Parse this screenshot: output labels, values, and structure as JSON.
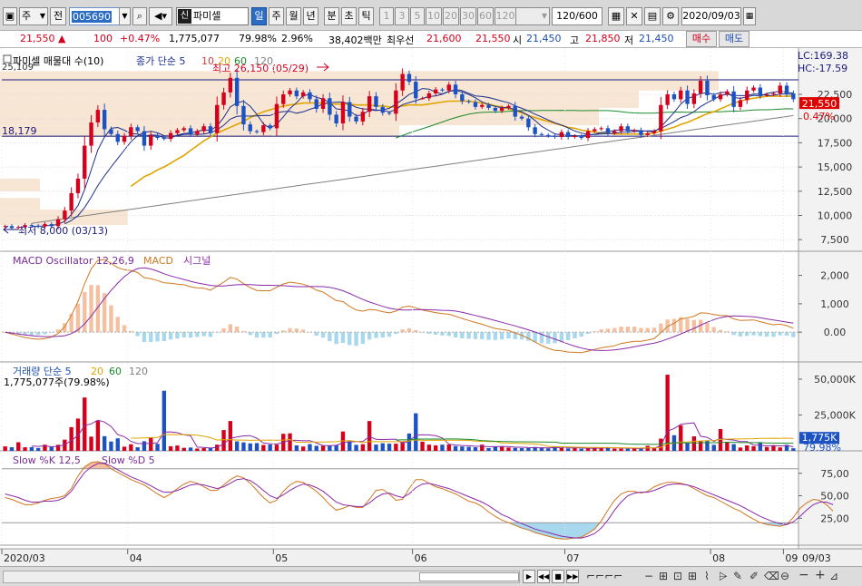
{
  "toolbar": {
    "type_label": "주",
    "prev_label": "전",
    "code": "005690",
    "name_prefix": "신",
    "name": "파미셀",
    "periods": [
      "일",
      "주",
      "월",
      "년",
      "분",
      "초",
      "틱"
    ],
    "selected_period": "일",
    "intervals": [
      "1",
      "3",
      "5",
      "10",
      "20",
      "30",
      "60",
      "120"
    ],
    "count": "120/600",
    "date": "2020/09/03"
  },
  "quote": {
    "price": "21,550",
    "change": "100",
    "change_pct": "+0.47%",
    "volume": "1,775,077",
    "volume_ratio": "79.98%",
    "turnover_ratio": "2.96%",
    "amount": "38,402백만",
    "best_label": "최우선",
    "best_ask": "21,600",
    "best_bid": "21,550",
    "open_label": "시",
    "open": "21,450",
    "high_label": "고",
    "high": "21,850",
    "low_label": "저",
    "low": "21,450",
    "buy_label": "매수",
    "sell_label": "매도"
  },
  "colors": {
    "up": "#d4001c",
    "down": "#1c52c4",
    "ma5": "#1a2f8f",
    "ma20": "#e0a400",
    "ma60": "#1a8a2a",
    "ma120": "#808080",
    "macd": "#d07820",
    "signal": "#8a2aa8",
    "hist_pos": "#f5c0a0",
    "hist_neg": "#a8d8ee",
    "zone": "#f8e6d4",
    "hline": "#1a1a7a"
  },
  "chart_data": [
    {
      "type": "candlestick",
      "panel_label": "파미셀 매물대 수(10)",
      "legend": [
        "종가 단순 5",
        "10",
        "20",
        "60",
        "120"
      ],
      "x_tick_labels": [
        "2020/03",
        "04",
        "05",
        "06",
        "07",
        "08",
        "09",
        "09/03"
      ],
      "y_ticks": [
        "22,500",
        "20,000",
        "17,500",
        "15,000",
        "12,500",
        "10,000",
        "7,500"
      ],
      "ylim": [
        6300,
        26900
      ],
      "top_left_value": "25,109",
      "support_label": "18,179",
      "high_annotation": "최고 26,150 (05/29)",
      "low_annotation": "최저 8,000 (03/13)",
      "lc_label": "LC:169.38",
      "hc_label": "HC:-17.59",
      "last_price": "21,550",
      "last_change": "0.47%",
      "hlines": [
        24000,
        18179
      ],
      "volume_profile": [
        {
          "low": 22900,
          "high": 24900,
          "value": 0.9
        },
        {
          "low": 21100,
          "high": 22900,
          "value": 0.8
        },
        {
          "low": 19300,
          "high": 21100,
          "value": 0.75
        },
        {
          "low": 18100,
          "high": 19300,
          "value": 0.5
        },
        {
          "low": 12500,
          "high": 13800,
          "value": 0.05
        },
        {
          "low": 10600,
          "high": 11800,
          "value": 0.05
        },
        {
          "low": 9000,
          "high": 10600,
          "value": 0.16
        }
      ],
      "close": [
        8900,
        8700,
        8800,
        9000,
        8950,
        8850,
        9100,
        8900,
        9600,
        10500,
        12300,
        13800,
        17200,
        19600,
        20900,
        18900,
        18400,
        17600,
        18200,
        19100,
        18700,
        17200,
        18300,
        18000,
        17900,
        18500,
        18800,
        19000,
        18400,
        18700,
        19200,
        18500,
        21400,
        22700,
        24200,
        21300,
        19400,
        18700,
        18600,
        19300,
        19000,
        21500,
        22500,
        22900,
        22300,
        22700,
        22000,
        21000,
        22100,
        20400,
        19500,
        21700,
        20200,
        19700,
        20700,
        22300,
        21200,
        20600,
        20500,
        22900,
        24600,
        23800,
        22100,
        22100,
        22600,
        23000,
        22900,
        23500,
        22500,
        21800,
        21700,
        21200,
        21400,
        21100,
        20800,
        21100,
        21300,
        20200,
        20000,
        19100,
        18400,
        18300,
        18200,
        18100,
        18600,
        18100,
        18200,
        18000,
        18700,
        18900,
        19000,
        18500,
        18700,
        19200,
        18700,
        18800,
        18300,
        18500,
        18700,
        21400,
        22500,
        22000,
        22900,
        21500,
        22600,
        23900,
        22400,
        22000,
        22500,
        22800,
        21200,
        21900,
        22900,
        23200,
        22400,
        22500,
        22600,
        23400,
        22600,
        22000
      ],
      "ma20": [
        null,
        null,
        null,
        null,
        null,
        null,
        null,
        null,
        null,
        null,
        null,
        null,
        null,
        null,
        null,
        null,
        null,
        null,
        null,
        13000,
        13500,
        14000,
        14300,
        14700,
        15000,
        15400,
        15800,
        16200,
        16700,
        17200,
        17700,
        18100,
        18500,
        18800,
        19100,
        19400,
        19700,
        20100,
        20400,
        20700,
        20900,
        21100,
        21300,
        21400,
        21500,
        21600,
        21600,
        21600,
        21600,
        21500,
        21500,
        21500,
        21500,
        21400,
        21400,
        21400,
        21300,
        21300,
        21200,
        21200,
        21300,
        21400,
        21400,
        21400,
        21500,
        21600,
        21700,
        21800,
        21800,
        21800,
        21800,
        21700,
        21600,
        21500,
        21300,
        21200,
        21000,
        20800,
        20600,
        20300,
        20100,
        19900,
        19700,
        19500,
        19300,
        19100,
        19000,
        18800,
        18700,
        18600,
        18500,
        18500,
        18400,
        18400,
        18400,
        18400,
        18400,
        18400,
        18500,
        18700,
        18900,
        19100,
        19400,
        19600,
        19900,
        20200,
        20500,
        20700,
        21000,
        21300,
        21600,
        21800,
        22000,
        22100,
        22200,
        22300,
        22300,
        22300,
        22300,
        22300
      ]
    },
    {
      "type": "line",
      "panel_label": "MACD Oscillator 12,26,9",
      "series_labels": [
        "MACD",
        "시그널"
      ],
      "y_ticks": [
        "2,000",
        "1,000",
        "0.00"
      ],
      "ylim": [
        -1050,
        2850
      ],
      "macd": [
        0,
        -70,
        -130,
        -190,
        -230,
        -250,
        -230,
        -170,
        -50,
        190,
        590,
        1080,
        1710,
        2230,
        2530,
        2560,
        2420,
        2270,
        2200,
        2170,
        2100,
        1920,
        1880,
        1820,
        1740,
        1720,
        1690,
        1670,
        1600,
        1560,
        1550,
        1480,
        1620,
        1760,
        1930,
        1870,
        1710,
        1570,
        1470,
        1460,
        1460,
        1580,
        1700,
        1760,
        1730,
        1690,
        1610,
        1480,
        1410,
        1260,
        1110,
        1080,
        910,
        780,
        740,
        800,
        780,
        720,
        680,
        740,
        880,
        920,
        860,
        780,
        730,
        690,
        650,
        630,
        560,
        480,
        410,
        340,
        280,
        200,
        130,
        90,
        60,
        -30,
        -110,
        -220,
        -350,
        -470,
        -570,
        -640,
        -660,
        -700,
        -710,
        -720,
        -670,
        -610,
        -550,
        -520,
        -480,
        -400,
        -360,
        -320,
        -320,
        -280,
        -230,
        -20,
        200,
        310,
        470,
        500,
        560,
        680,
        670,
        620,
        590,
        580,
        470,
        410,
        420,
        430,
        370,
        310,
        260,
        280,
        230,
        140
      ]
    },
    {
      "type": "bar",
      "panel_label": "거래량 단순 5",
      "legend": [
        "거래량 단순 5",
        "20",
        "60",
        "120"
      ],
      "volume_text": "1,775,077주(79.98%)",
      "y_ticks": [
        "50,000K",
        "25,000K"
      ],
      "ylim": [
        0,
        62000
      ],
      "last_volume": "1,775K",
      "last_volume_pct": "79.98%",
      "volume": [
        3100,
        2500,
        6000,
        2500,
        2600,
        2000,
        4300,
        2800,
        4200,
        7800,
        16500,
        22500,
        37200,
        9900,
        20900,
        10200,
        6500,
        8700,
        2900,
        4600,
        2500,
        6700,
        9500,
        4900,
        41900,
        3200,
        3700,
        2100,
        2300,
        1600,
        1900,
        1900,
        4300,
        14500,
        20800,
        6600,
        5900,
        5200,
        5400,
        4100,
        4400,
        4300,
        11900,
        12200,
        3800,
        3000,
        4700,
        3500,
        3500,
        3600,
        4000,
        13500,
        6600,
        4200,
        4600,
        20800,
        4400,
        5300,
        5000,
        5000,
        6200,
        12100,
        26200,
        6400,
        4300,
        3800,
        4300,
        4400,
        3300,
        3000,
        2800,
        2500,
        4300,
        1900,
        3100,
        3200,
        2300,
        2000,
        1900,
        1900,
        2700,
        2100,
        1700,
        3000,
        1900,
        1600,
        2100,
        1500,
        1800,
        2200,
        2000,
        2600,
        1500,
        1500,
        1500,
        1900,
        1500,
        3500,
        1800,
        8500,
        53100,
        10900,
        17800,
        5500,
        10100,
        6700,
        7100,
        4200,
        15200,
        6300,
        4700,
        2300,
        3800,
        3200,
        5400,
        2700,
        3500,
        2400,
        4200,
        1800
      ]
    },
    {
      "type": "line",
      "panel_label": "Slow %K 12,5",
      "series_labels": [
        "Slow %K 12,5",
        "Slow %D 5"
      ],
      "y_ticks": [
        "75,00",
        "50,00",
        "25,00"
      ],
      "ylim": [
        -5,
        100
      ],
      "k": [
        48,
        46,
        43,
        40,
        40,
        42,
        45,
        47,
        48,
        50,
        58,
        72,
        82,
        87,
        88,
        86,
        80,
        76,
        72,
        68,
        65,
        62,
        57,
        52,
        48,
        52,
        58,
        63,
        66,
        64,
        60,
        56,
        56,
        62,
        68,
        72,
        70,
        64,
        56,
        48,
        42,
        45,
        55,
        62,
        66,
        65,
        60,
        55,
        48,
        40,
        34,
        36,
        39,
        37,
        37,
        46,
        56,
        57,
        52,
        45,
        46,
        58,
        68,
        68,
        64,
        60,
        58,
        55,
        52,
        48,
        44,
        42,
        38,
        32,
        27,
        23,
        20,
        17,
        14,
        12,
        9,
        7,
        5,
        3,
        2,
        2,
        3,
        4,
        8,
        13,
        22,
        34,
        45,
        52,
        55,
        55,
        53,
        55,
        60,
        63,
        65,
        65,
        64,
        62,
        58,
        54,
        50,
        48,
        44,
        40,
        36,
        33,
        28,
        24,
        20,
        18,
        17,
        16,
        18,
        26,
        36,
        42,
        46,
        45,
        40,
        33
      ],
      "d": [
        52,
        50,
        48,
        45,
        43,
        43,
        44,
        44,
        45,
        48,
        55,
        66,
        76,
        82,
        86,
        86,
        83,
        79,
        75,
        71,
        68,
        65,
        61,
        57,
        54,
        54,
        56,
        59,
        62,
        63,
        62,
        60,
        58,
        60,
        64,
        68,
        69,
        67,
        62,
        56,
        50,
        47,
        51,
        56,
        60,
        63,
        62,
        59,
        55,
        49,
        43,
        40,
        39,
        38,
        38,
        42,
        48,
        52,
        53,
        50,
        48,
        52,
        59,
        63,
        64,
        62,
        60,
        58,
        55,
        52,
        49,
        46,
        43,
        39,
        34,
        29,
        26,
        22,
        19,
        16,
        13,
        11,
        9,
        7,
        5,
        4,
        3,
        3,
        5,
        8,
        14,
        23,
        34,
        43,
        50,
        53,
        54,
        54,
        56,
        59,
        62,
        63,
        63,
        62,
        60,
        57,
        54,
        51,
        48,
        45,
        42,
        39,
        35,
        31,
        27,
        24,
        21,
        19,
        18,
        21,
        27,
        34,
        40,
        43,
        43,
        40
      ]
    }
  ]
}
